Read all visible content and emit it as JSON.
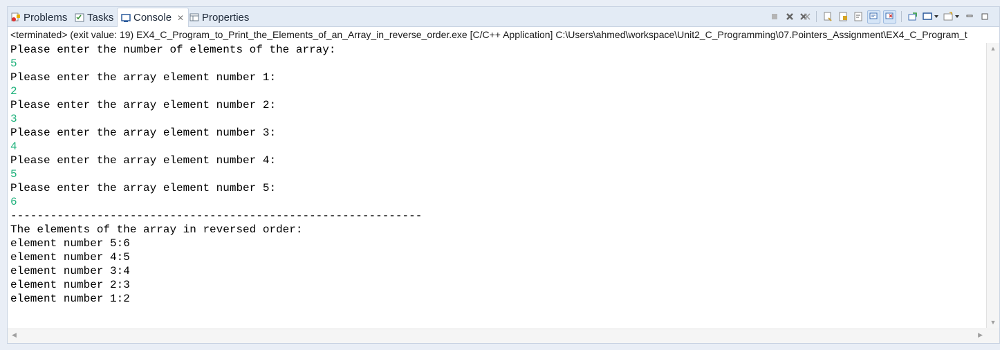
{
  "tabs": [
    {
      "label": "Problems",
      "icon": "problems-icon"
    },
    {
      "label": "Tasks",
      "icon": "tasks-icon"
    },
    {
      "label": "Console",
      "icon": "console-icon",
      "active": true
    },
    {
      "label": "Properties",
      "icon": "properties-icon"
    }
  ],
  "toolbar": {
    "icons": [
      "terminate-icon",
      "remove-launch-icon",
      "remove-all-terminated-icon",
      "clear-console-icon",
      "scroll-lock-icon",
      "word-wrap-icon",
      "show-on-stdout-icon",
      "show-on-stderr-icon",
      "pin-console-icon",
      "display-console-icon",
      "open-console-icon",
      "minimize-icon",
      "maximize-icon"
    ]
  },
  "status": "<terminated> (exit value: 19) EX4_C_Program_to_Print_the_Elements_of_an_Array_in_reverse_order.exe [C/C++ Application] C:\\Users\\ahmed\\workspace\\Unit2_C_Programming\\07.Pointers_Assignment\\EX4_C_Program_t",
  "console": {
    "lines": [
      {
        "text": "Please enter the number of elements of the array:",
        "type": "output"
      },
      {
        "text": "5",
        "type": "input"
      },
      {
        "text": "Please enter the array element number 1:",
        "type": "output"
      },
      {
        "text": "2",
        "type": "input"
      },
      {
        "text": "Please enter the array element number 2:",
        "type": "output"
      },
      {
        "text": "3",
        "type": "input"
      },
      {
        "text": "Please enter the array element number 3:",
        "type": "output"
      },
      {
        "text": "4",
        "type": "input"
      },
      {
        "text": "Please enter the array element number 4:",
        "type": "output"
      },
      {
        "text": "5",
        "type": "input"
      },
      {
        "text": "Please enter the array element number 5:",
        "type": "output"
      },
      {
        "text": "6",
        "type": "input"
      },
      {
        "text": "--------------------------------------------------------------",
        "type": "output"
      },
      {
        "text": "The elements of the array in reversed order:",
        "type": "output"
      },
      {
        "text": "element number 5:6",
        "type": "output"
      },
      {
        "text": "element number 4:5",
        "type": "output"
      },
      {
        "text": "element number 3:4",
        "type": "output"
      },
      {
        "text": "element number 2:3",
        "type": "output"
      },
      {
        "text": "element number 1:2",
        "type": "output"
      }
    ]
  },
  "colors": {
    "input_text": "#20b27c",
    "output_text": "#000000",
    "tab_bar": "#e3ebf5"
  }
}
